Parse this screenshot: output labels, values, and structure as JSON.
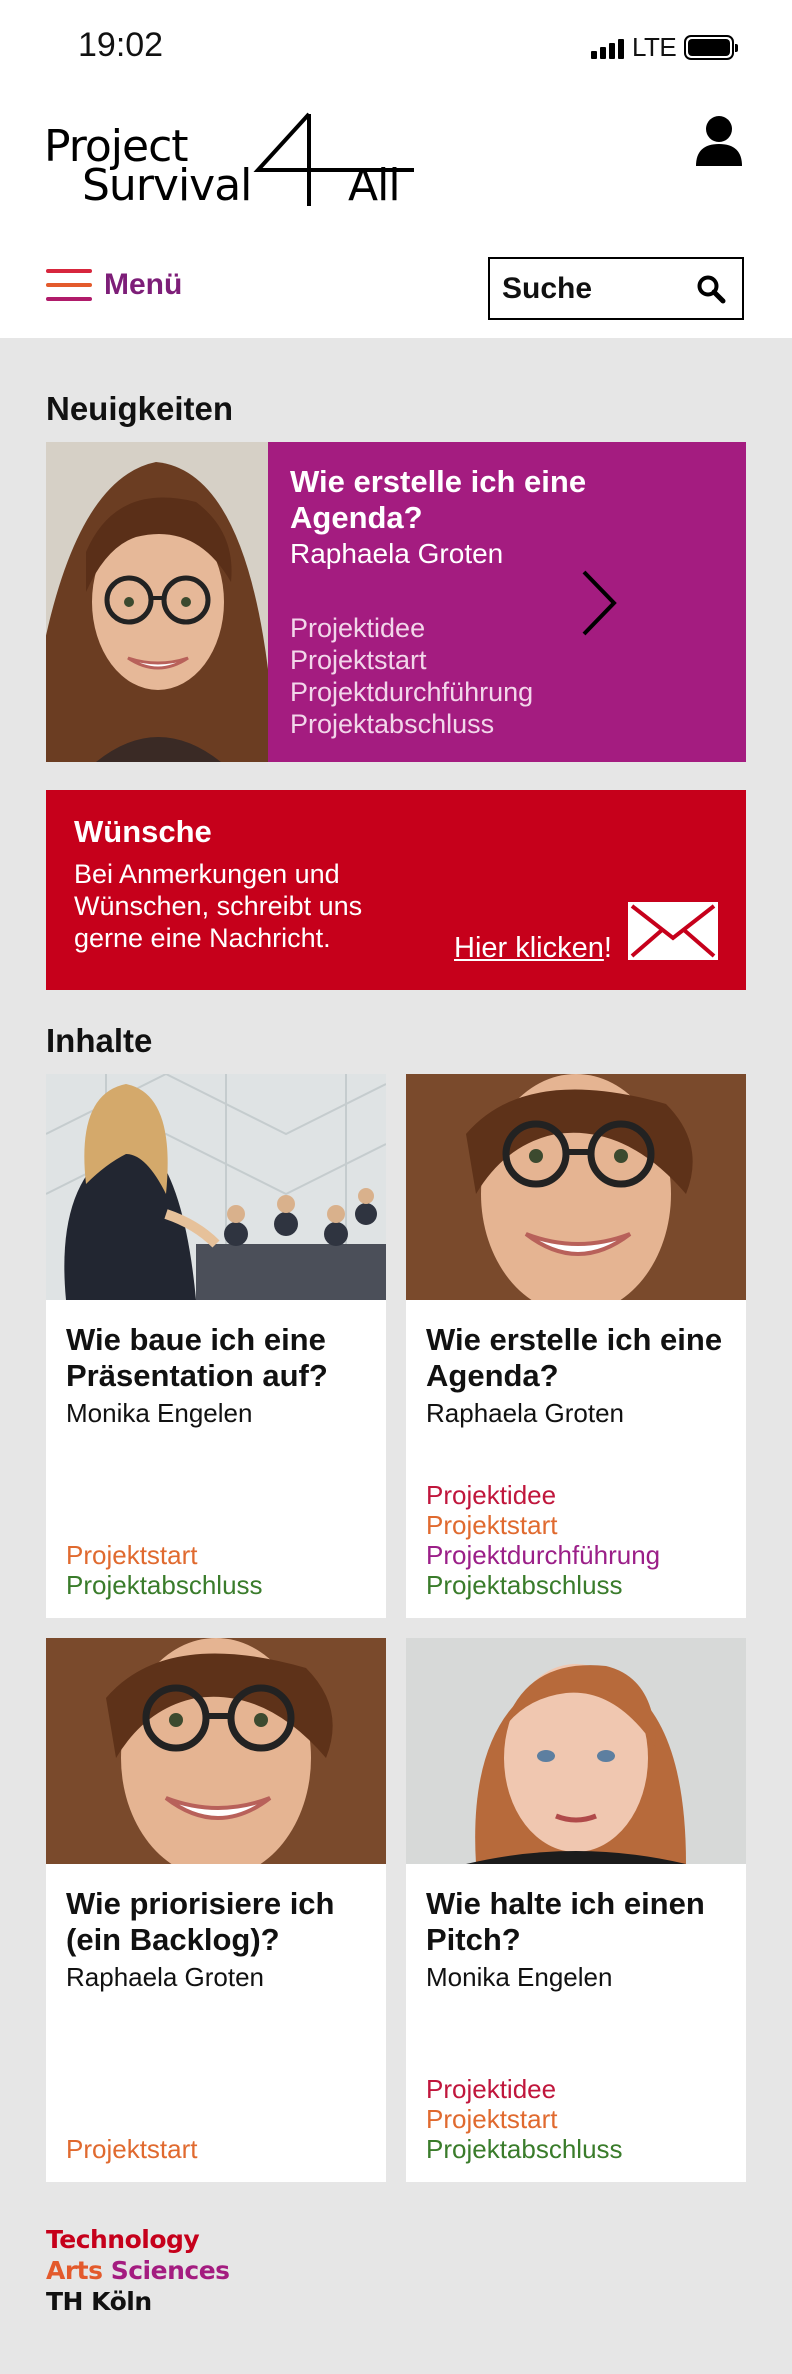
{
  "status_bar": {
    "time": "19:02",
    "network": "LTE"
  },
  "header": {
    "logo": {
      "line1": "Project",
      "line2": "Survival",
      "number": "4",
      "line3": "All"
    },
    "user_icon": "user-icon",
    "menu_label": "Menü",
    "search_label": "Suche",
    "search_icon": "search-icon"
  },
  "news": {
    "heading": "Neuigkeiten",
    "title": "Wie erstelle ich eine Agenda?",
    "author": "Raphaela Groten",
    "tags": [
      "Projektidee",
      "Projektstart",
      "Projektdurchführung",
      "Projektabschluss"
    ],
    "arrow_icon": "chevron-right-icon"
  },
  "wishes": {
    "title": "Wünsche",
    "text": "Bei Anmerkungen und Wünschen, schreibt uns gerne eine Nachricht.",
    "link_label": "Hier klicken",
    "link_suffix": "!",
    "icon": "mail-icon"
  },
  "content": {
    "heading": "Inhalte",
    "cards": [
      {
        "title": "Wie baue ich eine Präsentation auf?",
        "author": "Monika Engelen",
        "tags": [
          {
            "label": "Projektstart",
            "kind": "start"
          },
          {
            "label": "Projektabschluss",
            "kind": "ab"
          }
        ]
      },
      {
        "title": "Wie erstelle ich eine Agenda?",
        "author": "Raphaela Groten",
        "tags": [
          {
            "label": "Projektidee",
            "kind": "idee"
          },
          {
            "label": "Projektstart",
            "kind": "start"
          },
          {
            "label": "Projektdurchführung",
            "kind": "durch"
          },
          {
            "label": "Projektabschluss",
            "kind": "ab"
          }
        ]
      },
      {
        "title": "Wie priorisiere ich (ein Backlog)?",
        "author": "Raphaela Groten",
        "tags": [
          {
            "label": "Projektstart",
            "kind": "start"
          }
        ]
      },
      {
        "title": "Wie halte ich einen Pitch?",
        "author": "Monika Engelen",
        "tags": [
          {
            "label": "Projektidee",
            "kind": "idee"
          },
          {
            "label": "Projektstart",
            "kind": "start"
          },
          {
            "label": "Projektabschluss",
            "kind": "ab"
          }
        ]
      }
    ]
  },
  "footer_logo": {
    "line1": "Technology",
    "line2a": "Arts",
    "line2b": "Sciences",
    "line3": "TH Köln"
  },
  "colors": {
    "news_bg": "#a41c80",
    "wishes_bg": "#c6001b",
    "menu_text": "#7d1e78",
    "tag_projektidee": "#c0163c",
    "tag_projektstart": "#e06a2f",
    "tag_projektdurchfuehrung": "#9b1f88",
    "tag_projektabschluss": "#3a7c2b"
  }
}
